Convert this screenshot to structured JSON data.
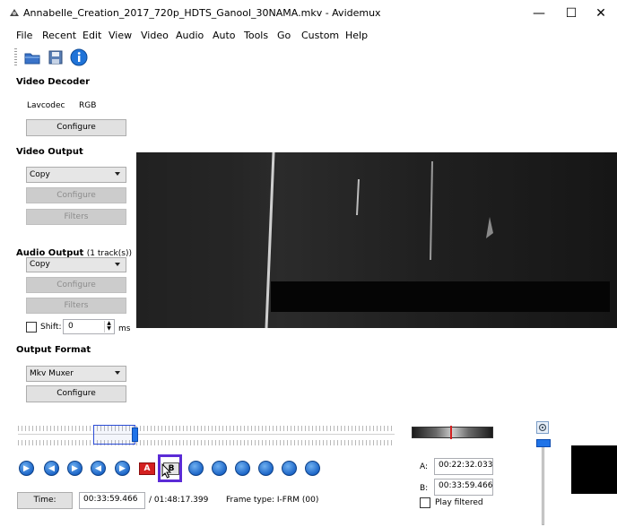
{
  "window": {
    "title": "Annabelle_Creation_2017_720p_HDTS_Ganool_30NAMA.mkv - Avidemux",
    "minimize_glyph": "—",
    "maximize_glyph": "☐",
    "close_glyph": "✕"
  },
  "menu": {
    "items": [
      {
        "label": "File"
      },
      {
        "label": "Recent"
      },
      {
        "label": "Edit"
      },
      {
        "label": "View"
      },
      {
        "label": "Video"
      },
      {
        "label": "Audio"
      },
      {
        "label": "Auto"
      },
      {
        "label": "Tools"
      },
      {
        "label": "Go"
      },
      {
        "label": "Custom"
      },
      {
        "label": "Help"
      }
    ]
  },
  "toolbar": {
    "icons": [
      "open-folder-icon",
      "save-disk-icon",
      "info-icon"
    ]
  },
  "video_decoder": {
    "title": "Video Decoder",
    "codec": "Lavcodec",
    "format": "RGB",
    "configure_label": "Configure"
  },
  "video_output": {
    "title": "Video Output",
    "selected": "Copy",
    "configure_label": "Configure",
    "filters_label": "Filters"
  },
  "audio_output": {
    "title": "Audio Output",
    "tracks": "(1 track(s))",
    "selected": "Copy",
    "configure_label": "Configure",
    "filters_label": "Filters",
    "shift_label": "Shift:",
    "shift_value": "0",
    "shift_unit": "ms"
  },
  "output_format": {
    "title": "Output Format",
    "selected": "Mkv Muxer",
    "configure_label": "Configure"
  },
  "navigation": {
    "position_fraction": 0.31,
    "buttons": [
      {
        "name": "play-button",
        "glyph": "▶"
      },
      {
        "name": "previous-frame-button",
        "glyph": "◀"
      },
      {
        "name": "next-frame-button",
        "glyph": "▶"
      },
      {
        "name": "previous-keyframe-button",
        "glyph": "◀"
      },
      {
        "name": "next-keyframe-button",
        "glyph": "▶"
      }
    ],
    "marker_a_label": "A",
    "marker_b_label": "B",
    "after_buttons": [
      {
        "name": "previous-black-button"
      },
      {
        "name": "next-black-button"
      },
      {
        "name": "first-frame-button"
      },
      {
        "name": "last-frame-button"
      },
      {
        "name": "go-back-button"
      },
      {
        "name": "go-forward-button"
      }
    ]
  },
  "selection": {
    "a_label": "A:",
    "a_time": "00:22:32.033",
    "b_label": "B:",
    "b_time": "00:33:59.466",
    "play_filtered_label": "Play filtered"
  },
  "status": {
    "time_label": "Time:",
    "current_time": "00:33:59.466",
    "duration": "/ 01:48:17.399",
    "frame_type": "Frame type: I-FRM (00)"
  },
  "colors": {
    "highlight_box": "#5b2bd6",
    "blue_button": "#1d66c8",
    "marker_red": "#d42020"
  }
}
